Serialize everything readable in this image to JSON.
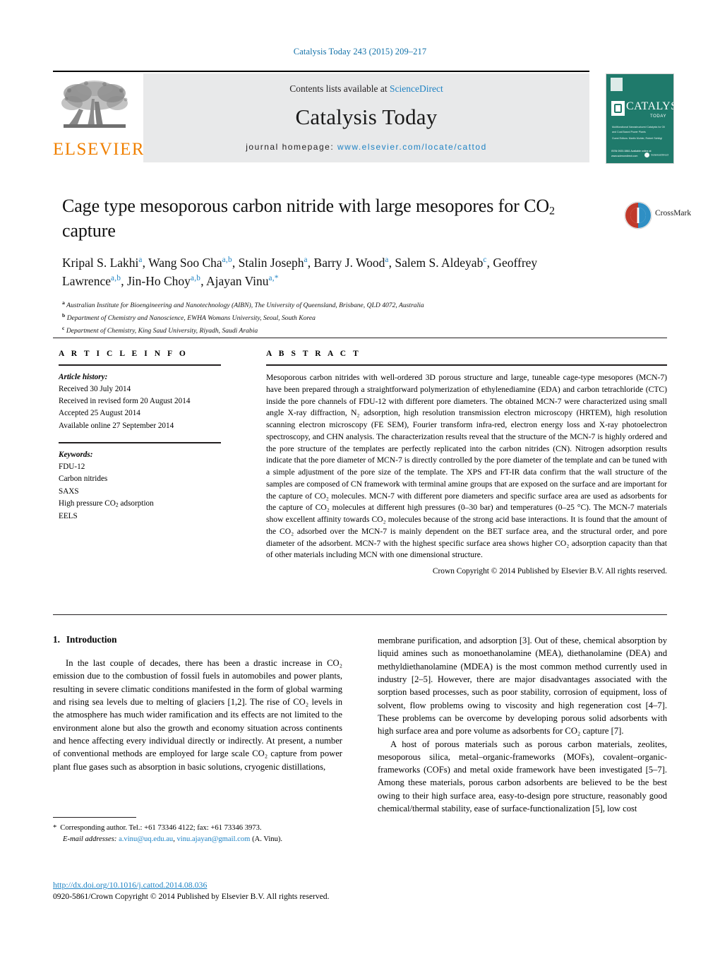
{
  "running_head": "Catalysis Today 243 (2015) 209–217",
  "masthead": {
    "contents_prefix": "Contents lists available at ",
    "sciencedirect": "ScienceDirect",
    "journal_title": "Catalysis Today",
    "homepage_label": "journal homepage:",
    "homepage_url": "www.elsevier.com/locate/cattod",
    "publisher_logo_text": "ELSEVIER",
    "publisher_logo_icon": "elsevier-tree-icon",
    "cover": {
      "title": "CATALYSIS",
      "subtitle": "TODAY",
      "blurb": "Multifunctional Nanostructured Catalysts for Oil and Coal Based Power Plants",
      "editors": "Guest Editors:\nMartin Muhler, Robert Schlögl",
      "badge": "ScienceDirect",
      "footer": "ISSN 0920-5861\nAvailable online at www.sciencedirect.com"
    }
  },
  "article": {
    "title_line1": "Cage type mesoporous carbon nitride with large mesopores for CO",
    "title_sub": "2",
    "title_line2": "capture",
    "crossmark_label": "CrossMark",
    "authors": [
      {
        "name": "Kripal S. Lakhi",
        "sup": "a",
        "sep": ", "
      },
      {
        "name": "Wang Soo Cha",
        "sup": "a,b",
        "sep": ", "
      },
      {
        "name": "Stalin Joseph",
        "sup": "a",
        "sep": ", "
      },
      {
        "name": "Barry J. Wood",
        "sup": "a",
        "sep": ", "
      },
      {
        "name": "Salem S. Aldeyab",
        "sup": "c",
        "sep": ","
      },
      {
        "name": "Geoffrey Lawrence",
        "sup": "a,b",
        "sep": ", "
      },
      {
        "name": "Jin-Ho Choy",
        "sup": "a,b",
        "sep": ", "
      },
      {
        "name": "Ajayan Vinu",
        "sup": "a,*",
        "sep": ""
      }
    ],
    "affiliations": [
      {
        "mark": "a",
        "text": "Australian Institute for Bioengineering and Nanotechnology (AIBN), The University of Queensland, Brisbane, QLD 4072, Australia"
      },
      {
        "mark": "b",
        "text": "Department of Chemistry and Nanoscience, EWHA Womans University, Seoul, South Korea"
      },
      {
        "mark": "c",
        "text": "Department of Chemistry, King Saud University, Riyadh, Saudi Arabia"
      }
    ]
  },
  "article_info": {
    "heading": "A R T I C L E   I N F O",
    "history_label": "Article history:",
    "history": [
      "Received 30 July 2014",
      "Received in revised form 20 August 2014",
      "Accepted 25 August 2014",
      "Available online 27 September 2014"
    ],
    "keywords_label": "Keywords:",
    "keywords_plain": [
      "FDU-12",
      "Carbon nitrides",
      "SAXS",
      "EELS"
    ],
    "keyword_co2": "High pressure CO",
    "keyword_co2_sub": "2",
    "keyword_co2_tail": " adsorption"
  },
  "abstract": {
    "heading": "A B S T R A C T",
    "text": "Mesoporous carbon nitrides with well-ordered 3D porous structure and large, tuneable cage-type mesopores (MCN-7) have been prepared through a straightforward polymerization of ethylenediamine (EDA) and carbon tetrachloride (CTC) inside the pore channels of FDU-12 with different pore diameters. The obtained MCN-7 were characterized using small angle X-ray diffraction, N₂ adsorption, high resolution transmission electron microscopy (HRTEM), high resolution scanning electron microscopy (FE SEM), Fourier transform infra-red, electron energy loss and X-ray photoelectron spectroscopy, and CHN analysis. The characterization results reveal that the structure of the MCN-7 is highly ordered and the pore structure of the templates are perfectly replicated into the carbon nitrides (CN). Nitrogen adsorption results indicate that the pore diameter of MCN-7 is directly controlled by the pore diameter of the template and can be tuned with a simple adjustment of the pore size of the template. The XPS and FT-IR data confirm that the wall structure of the samples are composed of CN framework with terminal amine groups that are exposed on the surface and are important for the capture of CO₂ molecules. MCN-7 with different pore diameters and specific surface area are used as adsorbents for the capture of CO₂ molecules at different high pressures (0–30 bar) and temperatures (0–25 °C). The MCN-7 materials show excellent affinity towards CO₂ molecules because of the strong acid base interactions. It is found that the amount of the CO₂ adsorbed over the MCN-7 is mainly dependent on the BET surface area, and the structural order, and pore diameter of the adsorbent. MCN-7 with the highest specific surface area shows higher CO₂ adsorption capacity than that of other materials including MCN with one dimensional structure.",
    "copyright": "Crown Copyright © 2014 Published by Elsevier B.V. All rights reserved."
  },
  "body": {
    "section_number": "1.",
    "section_title": "Introduction",
    "left_para_1": "In the last couple of decades, there has been a drastic increase in CO₂ emission due to the combustion of fossil fuels in automobiles and power plants, resulting in severe climatic conditions manifested in the form of global warming and rising sea levels due to melting of glaciers [1,2]. The rise of CO₂ levels in the atmosphere has much wider ramification and its effects are not limited to the environment alone but also the growth and economy situation across continents and hence affecting every individual directly or indirectly. At present, a number of conventional methods are employed for large scale CO₂ capture from power plant flue gases such as absorption in basic solutions, cryogenic distillations,",
    "right_para_1": "membrane purification, and adsorption [3]. Out of these, chemical absorption by liquid amines such as monoethanolamine (MEA), diethanolamine (DEA) and methyldiethanolamine (MDEA) is the most common method currently used in industry [2–5]. However, there are major disadvantages associated with the sorption based processes, such as poor stability, corrosion of equipment, loss of solvent, flow problems owing to viscosity and high regeneration cost [4–7]. These problems can be overcome by developing porous solid adsorbents with high surface area and pore volume as adsorbents for CO₂ capture [7].",
    "right_para_2": "A host of porous materials such as porous carbon materials, zeolites, mesoporous silica, metal–organic-frameworks (MOFs), covalent–organic-frameworks (COFs) and metal oxide framework have been investigated [5–7]. Among these materials, porous carbon adsorbents are believed to be the best owing to their high surface area, easy-to-design pore structure, reasonably good chemical/thermal stability, ease of surface-functionalization [5], low cost"
  },
  "footnotes": {
    "corresponding": "Corresponding author. Tel.: +61 73346 4122; fax: +61 73346 3973.",
    "email_label": "E-mail addresses:",
    "email_1": "a.vinu@uq.edu.au",
    "email_2": "vinu.ajayan@gmail.com",
    "email_suffix": "(A. Vinu).",
    "doi": "http://dx.doi.org/10.1016/j.cattod.2014.08.036",
    "issn_line": "0920-5861/Crown Copyright © 2014 Published by Elsevier B.V. All rights reserved."
  },
  "colors": {
    "link_blue": "#1f83c4",
    "running_head_blue": "#1070a8",
    "elsevier_orange": "#f08000",
    "masthead_grey": "#e8e9ea",
    "cover_green": "#1f7a6b"
  }
}
